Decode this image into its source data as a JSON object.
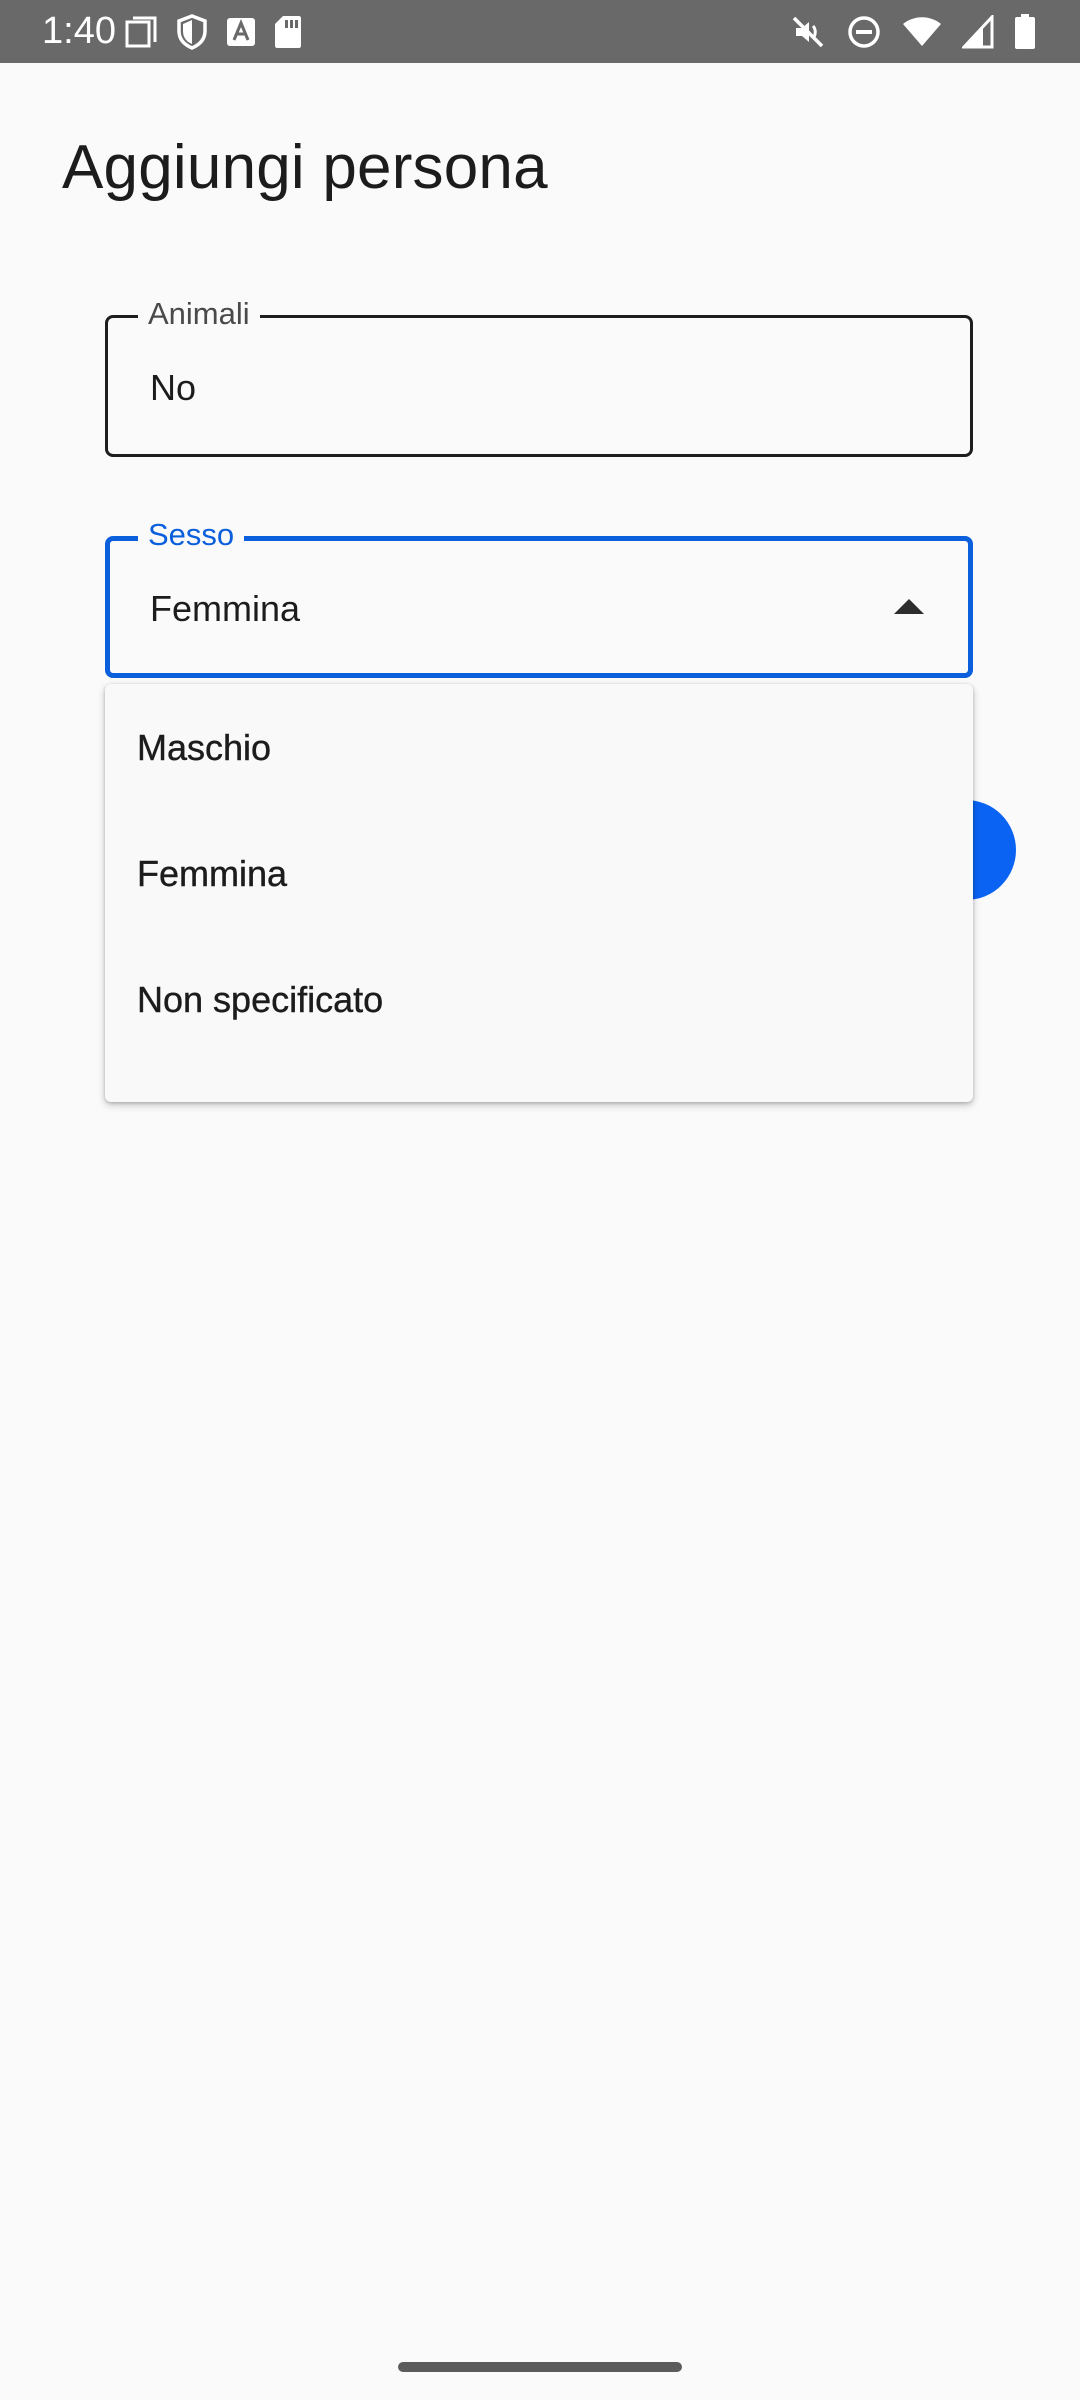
{
  "status_bar": {
    "time": "1:40",
    "left_icons": [
      "screenshot-icon",
      "shield-icon",
      "font-a-icon",
      "sd-card-icon"
    ],
    "right_icons": [
      "mute-vibrate-icon",
      "do-not-disturb-icon",
      "wifi-icon",
      "signal-icon",
      "battery-icon"
    ]
  },
  "page": {
    "title": "Aggiungi persona"
  },
  "fields": {
    "animali": {
      "label": "Animali",
      "value": "No"
    },
    "sesso": {
      "label": "Sesso",
      "value": "Femmina",
      "state": "expanded",
      "accent_color": "#0b5fdc"
    }
  },
  "dropdown": {
    "options": [
      {
        "label": "Maschio"
      },
      {
        "label": "Femmina"
      },
      {
        "label": "Non specificato"
      }
    ]
  },
  "colors": {
    "accent": "#0b5fdc",
    "fab": "#0b63f3",
    "status_bar": "#696969",
    "background": "#fafafa"
  }
}
